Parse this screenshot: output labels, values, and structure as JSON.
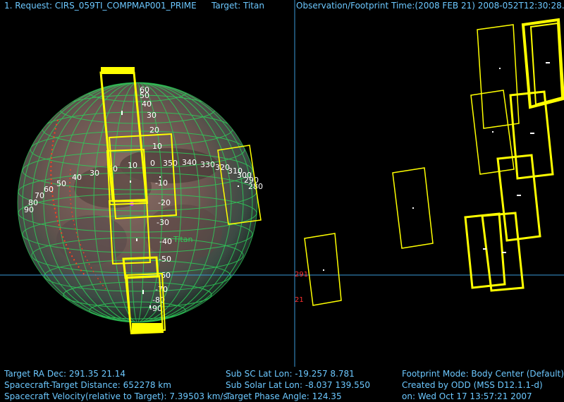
{
  "header": {
    "request": "1. Request: CIRS_059TI_COMPMAP001_PRIME",
    "target": "Target: Titan",
    "obs_time": "Observation/Footprint Time:(2008 FEB 21) 2008-052T12:30:28.50"
  },
  "body_label": "Titan",
  "grid_labels": {
    "lat_column": [
      "60",
      "50",
      "40",
      "30",
      "20",
      "10",
      "-10",
      "-20",
      "-30",
      "-40",
      "-50",
      "-60",
      "-70",
      "-80",
      "-90"
    ],
    "lon_row": [
      "90",
      "80",
      "70",
      "60",
      "50",
      "40",
      "30",
      "20",
      "10",
      "0",
      "350",
      "340",
      "330",
      "320",
      "310",
      "300",
      "290",
      "280"
    ],
    "zero": "0"
  },
  "right_axis_labels": {
    "ra": "291",
    "dec": "21"
  },
  "footer": {
    "left": [
      "Target RA Dec: 291.35  21.14",
      "Spacecraft-Target Distance:  652278 km",
      "Spacecraft Velocity(relative to Target): 7.39503 km/s"
    ],
    "middle": [
      "Sub SC Lat Lon: -19.257   8.781",
      "Sub Solar Lat Lon: -8.037  139.550",
      "Target Phase Angle: 124.35"
    ],
    "right": [
      "Footprint Mode: Body Center (Default)",
      "Created by ODD (MSS D12.1.1-d)",
      "on: Wed Oct 17 13:57:21 2007"
    ]
  },
  "colors": {
    "text": "#6cc8ff",
    "footprint": "#ffff00",
    "grid": "#2ecf5a",
    "label_lat": "#ffffff",
    "red_label": "#ff3030"
  }
}
